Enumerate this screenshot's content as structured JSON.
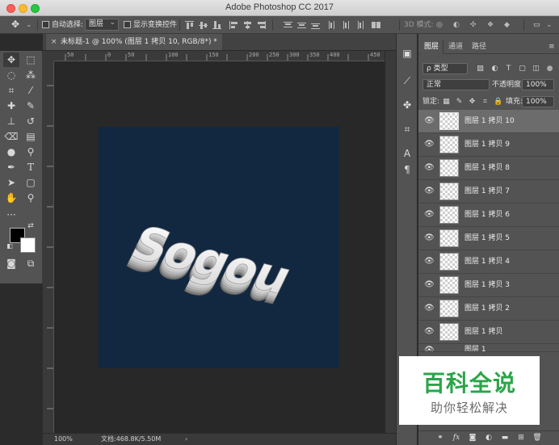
{
  "app_title": "Adobe Photoshop CC 2017",
  "options_bar": {
    "auto_select_label": "自动选择:",
    "auto_select_target": "图层",
    "show_transform_label": "显示变换控件",
    "mode_3d_label": "3D 模式:"
  },
  "document": {
    "tab_title": "未标题-1 @ 100% (图层 1 拷贝 10, RGB/8*) *",
    "close_glyph": "×",
    "canvas_color": "#122840",
    "artwork_text": "Sogou"
  },
  "ruler": {
    "ticks": [
      "50",
      "0",
      "50",
      "100",
      "150",
      "200",
      "250",
      "300",
      "350",
      "400",
      "450"
    ]
  },
  "status": {
    "zoom": "100%",
    "doc_size": "文档:468.8K/5.50M"
  },
  "colors": {
    "foreground": "#000000",
    "background": "#ffffff",
    "accent_green": "#2aa548"
  },
  "panel": {
    "tabs": [
      "图层",
      "通道",
      "路径"
    ],
    "filter_kind": "ρ 类型",
    "blend_mode": "正常",
    "opacity_label": "不透明度:",
    "opacity_value": "100%",
    "lock_label": "锁定:",
    "fill_label": "填充:",
    "fill_value": "100%",
    "layers": [
      {
        "name": "图层 1 拷贝 10",
        "selected": true
      },
      {
        "name": "图层 1 拷贝 9"
      },
      {
        "name": "图层 1 拷贝 8"
      },
      {
        "name": "图层 1 拷贝 7"
      },
      {
        "name": "图层 1 拷贝 6"
      },
      {
        "name": "图层 1 拷贝 5"
      },
      {
        "name": "图层 1 拷贝 4"
      },
      {
        "name": "图层 1 拷贝 3"
      },
      {
        "name": "图层 1 拷贝 2"
      },
      {
        "name": "图层 1 拷贝"
      },
      {
        "name": "图层 1"
      }
    ]
  },
  "watermark": {
    "title": "百科全说",
    "subtitle": "助你轻松解决"
  }
}
